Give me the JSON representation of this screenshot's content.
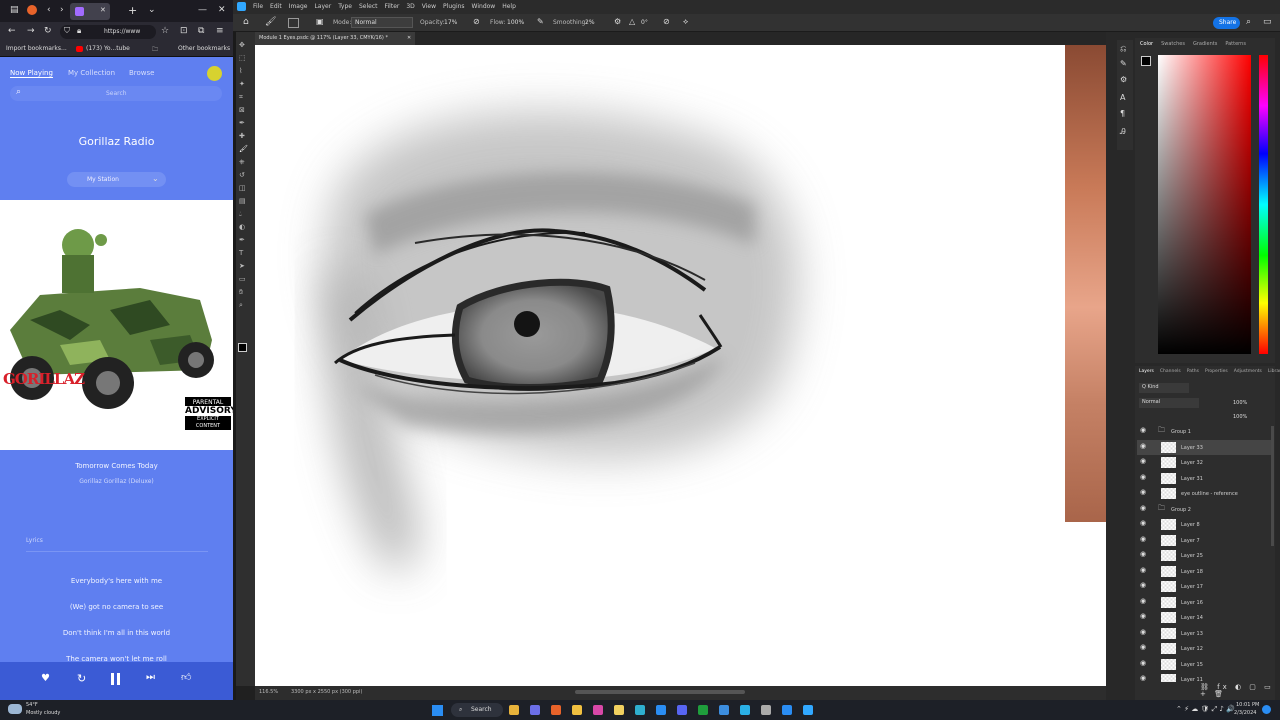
{
  "browser": {
    "url": "https://www",
    "bookmarks": [
      "Import bookmarks...",
      "(173) Yo...tube",
      "Other bookmarks"
    ]
  },
  "radio": {
    "tabs": [
      "Now Playing",
      "My Collection",
      "Browse"
    ],
    "search_placeholder": "Search",
    "title": "Gorillaz Radio",
    "station": "My Station",
    "cover_text": "GORILLAZ",
    "cover_badge_top": "PARENTAL",
    "cover_badge_main": "ADVISORY",
    "cover_badge_bottom": "EXPLICIT CONTENT",
    "track_title": "Tomorrow Comes Today",
    "track_meta": "Gorillaz    Gorillaz (Deluxe)",
    "lyrics_header": "Lyrics",
    "lyrics": [
      "Everybody's here with me",
      "(We) got no camera to see",
      "Don't think I'm all in this world",
      "The camera won't let me roll"
    ]
  },
  "photoshop": {
    "menu": [
      "File",
      "Edit",
      "Image",
      "Layer",
      "Type",
      "Select",
      "Filter",
      "3D",
      "View",
      "Plugins",
      "Window",
      "Help"
    ],
    "options": {
      "mode_label": "Mode:",
      "mode_value": "Normal",
      "opacity_label": "Opacity:",
      "opacity_value": "17%",
      "flow_label": "Flow:",
      "flow_value": "100%",
      "smoothing_label": "Smoothing:",
      "smoothing_value": "2%",
      "angle_value": "0°"
    },
    "share_label": "Share",
    "doc_tab": "Module 1 Eyes.psdc @ 117% (Layer 33, CMYK/16) *",
    "status": [
      "116.5%",
      "3300 px x 2550 px (300 ppi)"
    ],
    "color_tabs": [
      "Color",
      "Swatches",
      "Gradients",
      "Patterns"
    ],
    "layer_tabs": [
      "Layers",
      "Channels",
      "Paths",
      "Properties",
      "Adjustments",
      "Libraries"
    ],
    "layers_kind": "Q Kind",
    "blend_mode": "Normal",
    "layer_opacity": "100%",
    "fill": "100%",
    "layers": [
      {
        "name": "Group 1",
        "group": true
      },
      {
        "name": "Layer 33",
        "group": false,
        "selected": true
      },
      {
        "name": "Layer 32",
        "group": false
      },
      {
        "name": "Layer 31",
        "group": false
      },
      {
        "name": "eye outline - reference",
        "group": false
      },
      {
        "name": "Group 2",
        "group": true
      },
      {
        "name": "Layer 8",
        "group": false
      },
      {
        "name": "Layer 7",
        "group": false
      },
      {
        "name": "Layer 25",
        "group": false
      },
      {
        "name": "Layer 18",
        "group": false
      },
      {
        "name": "Layer 17",
        "group": false
      },
      {
        "name": "Layer 16",
        "group": false
      },
      {
        "name": "Layer 14",
        "group": false
      },
      {
        "name": "Layer 13",
        "group": false
      },
      {
        "name": "Layer 12",
        "group": false
      },
      {
        "name": "Layer 15",
        "group": false
      },
      {
        "name": "Layer 11",
        "group": false
      }
    ]
  },
  "taskbar": {
    "weather_temp": "54°F",
    "weather_desc": "Mostly cloudy",
    "search": "Search",
    "time": "10:01 PM",
    "date": "2/3/2024"
  },
  "colors": {
    "radio_bg": "#5f7ff0",
    "ps_bg": "#323232",
    "accent": "#1473e6"
  }
}
